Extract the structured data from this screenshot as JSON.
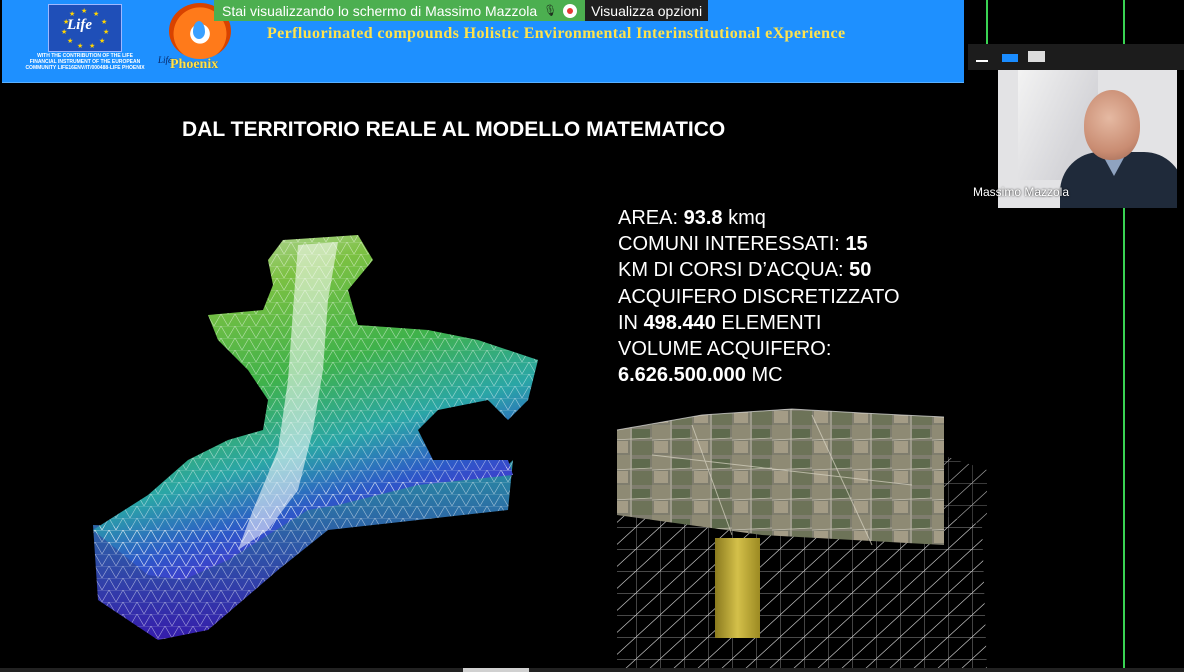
{
  "banner": {
    "eu_logo_text": "Life",
    "eu_caption": "WITH THE CONTRIBUTION OF THE LIFE FINANCIAL INSTRUMENT OF THE EUROPEAN COMMUNITY LIFE16ENV/IT/000488-LIFE PHOENIX",
    "phoenix_life_text": "Life",
    "phoenix_text": "Phoenix",
    "subtitle": "Perfluorinated compounds Holistic Environmental Interinstitutional eXperience"
  },
  "share_bar": {
    "text": "Stai visualizzando lo schermo di Massimo Mazzola",
    "options_label": "Visualizza opzioni"
  },
  "slide": {
    "title": "DAL TERRITORIO REALE AL MODELLO MATEMATICO",
    "facts": {
      "area_label": "AREA:",
      "area_value": "93.8",
      "area_unit": "kmq",
      "comuni_label": "COMUNI INTERESSATI:",
      "comuni_value": "15",
      "km_label": "KM DI CORSI D’ACQUA:",
      "km_value": "50",
      "acquifero_line1": "ACQUIFERO DISCRETIZZATO",
      "acquifero_prefix": "IN",
      "elementi_value": "498.440",
      "elementi_label": "ELEMENTI",
      "volume_label": "VOLUME ACQUIFERO:",
      "volume_value": "6.626.500.000",
      "volume_unit": "MC"
    }
  },
  "video": {
    "participant_name": "Massimo Mazzola"
  },
  "colors": {
    "banner_blue": "#1e90ff",
    "banner_text_yellow": "#ffe34d",
    "share_green": "#4caf50",
    "active_speaker_green": "#39d353",
    "view_icon_blue": "#1a8cff"
  },
  "icons": [
    "eu-flag-icon",
    "phoenix-logo-icon",
    "mic-muted-icon",
    "recording-icon",
    "minimize-icon",
    "speaker-view-icon",
    "gallery-view-icon"
  ]
}
